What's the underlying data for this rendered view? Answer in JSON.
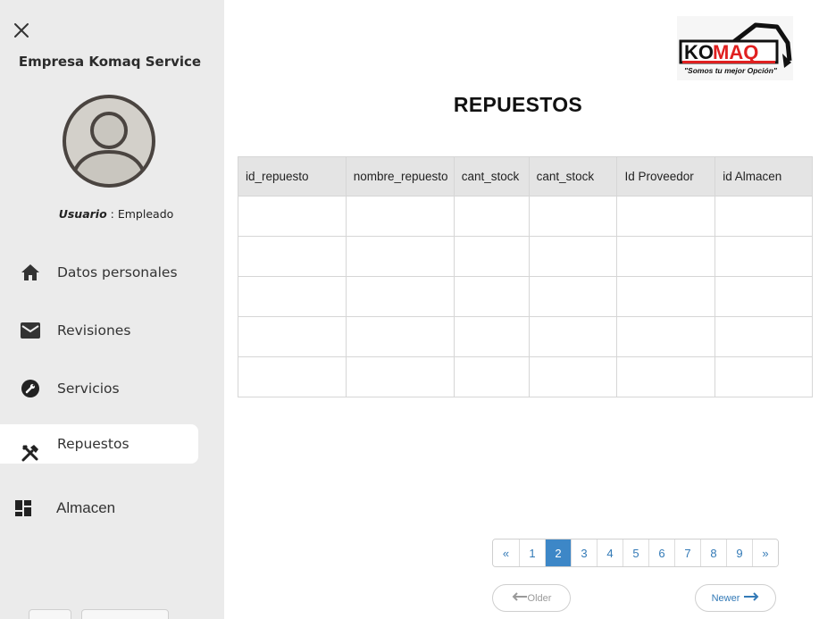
{
  "sidebar": {
    "company": "Empresa Komaq Service",
    "role_label": "Usuario",
    "role_sep": " : ",
    "role_value": "Empleado",
    "items": [
      {
        "label": "Datos personales",
        "icon": "home-icon"
      },
      {
        "label": "Revisiones",
        "icon": "mail-icon"
      },
      {
        "label": "Servicios",
        "icon": "wrench-icon"
      },
      {
        "label": "Repuestos",
        "icon": "tools-icon"
      },
      {
        "label": "Almacen",
        "icon": "dashboard-icon"
      }
    ],
    "active_item": "Repuestos"
  },
  "logo": {
    "text_ko": "KO",
    "text_maq": "MAQ",
    "tagline": "\"Somos tu mejor Opción\"",
    "accent_color": "#e02020"
  },
  "main": {
    "title": "REPUESTOS",
    "table": {
      "columns": [
        "id_repuesto",
        "nombre_repuesto",
        "cant_stock",
        "cant_stock",
        "Id Proveedor",
        "id Almacen"
      ],
      "rows": [
        [
          "",
          "",
          "",
          "",
          "",
          ""
        ],
        [
          "",
          "",
          "",
          "",
          "",
          ""
        ],
        [
          "",
          "",
          "",
          "",
          "",
          ""
        ],
        [
          "",
          "",
          "",
          "",
          "",
          ""
        ],
        [
          "",
          "",
          "",
          "",
          "",
          ""
        ]
      ]
    },
    "pagination": {
      "first": "«",
      "pages": [
        "1",
        "2",
        "3",
        "4",
        "5",
        "6",
        "7",
        "8",
        "9"
      ],
      "last": "»",
      "current": "2"
    },
    "pager": {
      "older": "Older",
      "newer": "Newer"
    }
  },
  "colors": {
    "sidebar_bg": "#ebebeb",
    "active_page": "#3d87c7",
    "link": "#337ab7"
  }
}
